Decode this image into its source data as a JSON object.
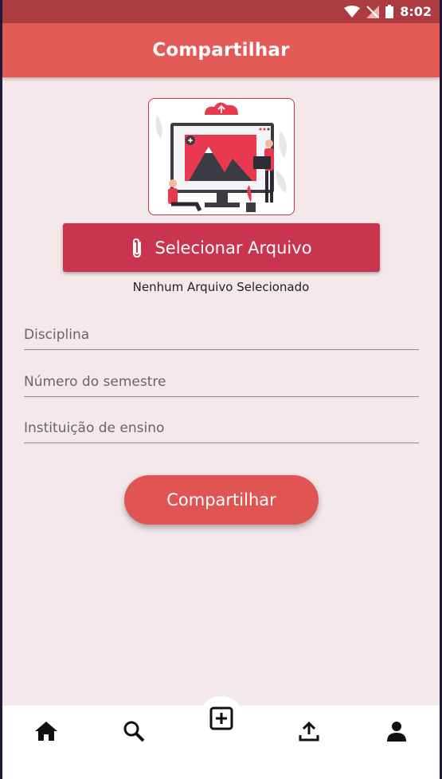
{
  "status_bar": {
    "time": "8:02"
  },
  "app_bar": {
    "title": "Compartilhar"
  },
  "file": {
    "select_label": "Selecionar Arquivo",
    "status_text": "Nenhum Arquivo Selecionado"
  },
  "form": {
    "discipline_placeholder": "Disciplina",
    "semester_placeholder": "Número do semestre",
    "institution_placeholder": "Instituição de ensino"
  },
  "submit_label": "Compartilhar",
  "bottom_nav": {
    "items": [
      "home-icon",
      "search-icon",
      "add-box-icon",
      "upload-icon",
      "person-icon"
    ],
    "active": "add-box-icon"
  },
  "colors": {
    "status_bar": "#ad3c40",
    "app_bar": "#e45a57",
    "primary_button": "#c9344f",
    "submit_button": "#e05553",
    "background": "#f4e8ea"
  }
}
